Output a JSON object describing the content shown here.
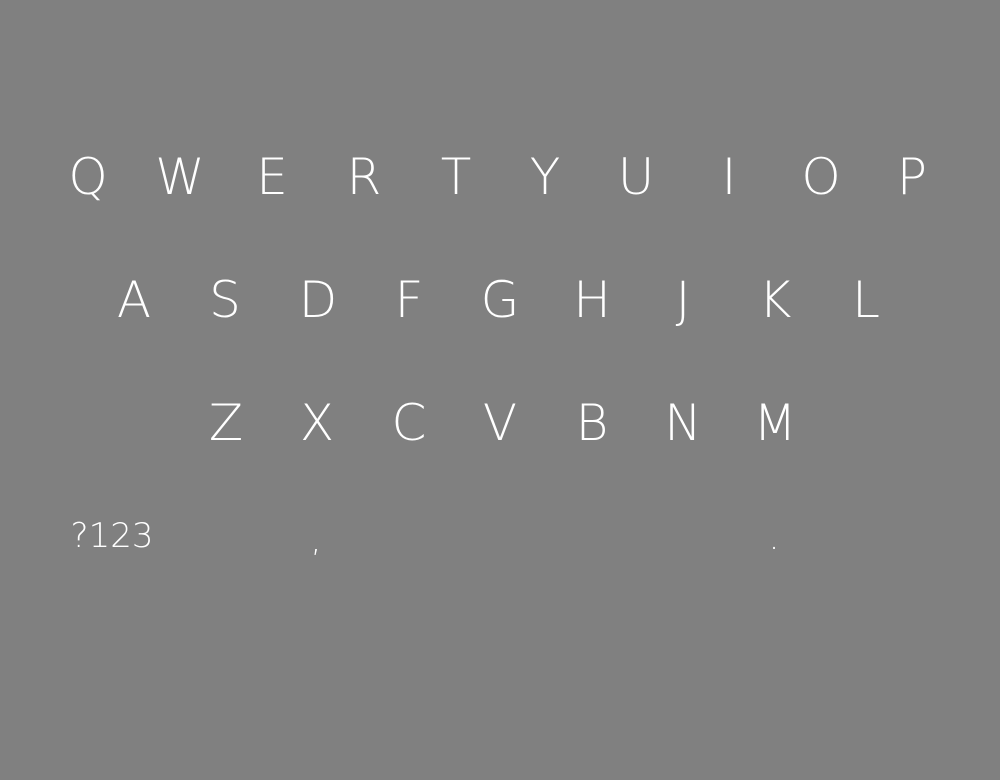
{
  "keyboard": {
    "row1": [
      "Q",
      "W",
      "E",
      "R",
      "T",
      "Y",
      "U",
      "I",
      "O",
      "P"
    ],
    "row2": [
      "A",
      "S",
      "D",
      "F",
      "G",
      "H",
      "J",
      "K",
      "L"
    ],
    "row3": [
      "Z",
      "X",
      "C",
      "V",
      "B",
      "N",
      "M"
    ],
    "bottom": {
      "symbols": "?123",
      "comma": ",",
      "period": "."
    }
  },
  "colors": {
    "background": "#808080",
    "key_text": "#ffffff"
  }
}
